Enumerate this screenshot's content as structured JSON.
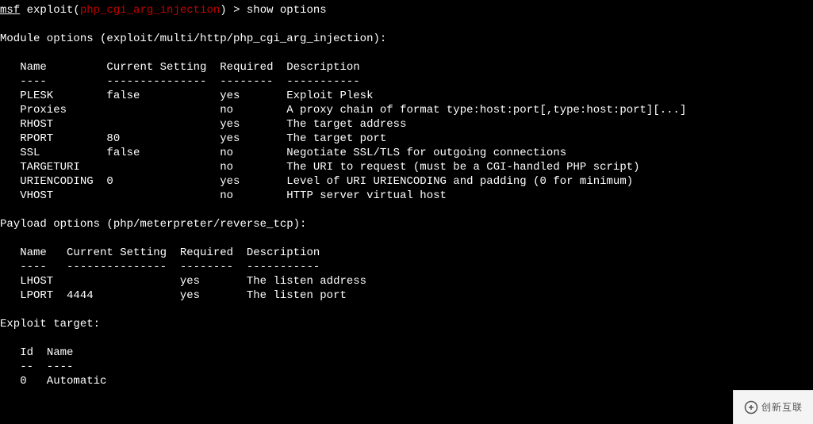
{
  "prompt": {
    "msf": "msf",
    "pre": " exploit(",
    "name": "php_cgi_arg_injection",
    "post": ") > ",
    "cmd": "show options"
  },
  "module_header": "Module options (exploit/multi/http/php_cgi_arg_injection):",
  "module_cols": {
    "name": "Name",
    "setting": "Current Setting",
    "required": "Required",
    "desc": "Description"
  },
  "module_divider": {
    "name": "----",
    "setting": "---------------",
    "required": "--------",
    "desc": "-----------"
  },
  "module_rows": [
    {
      "name": "PLESK",
      "setting": "false",
      "required": "yes",
      "desc": "Exploit Plesk"
    },
    {
      "name": "Proxies",
      "setting": "",
      "required": "no",
      "desc": "A proxy chain of format type:host:port[,type:host:port][...]"
    },
    {
      "name": "RHOST",
      "setting": "",
      "required": "yes",
      "desc": "The target address"
    },
    {
      "name": "RPORT",
      "setting": "80",
      "required": "yes",
      "desc": "The target port"
    },
    {
      "name": "SSL",
      "setting": "false",
      "required": "no",
      "desc": "Negotiate SSL/TLS for outgoing connections"
    },
    {
      "name": "TARGETURI",
      "setting": "",
      "required": "no",
      "desc": "The URI to request (must be a CGI-handled PHP script)"
    },
    {
      "name": "URIENCODING",
      "setting": "0",
      "required": "yes",
      "desc": "Level of URI URIENCODING and padding (0 for minimum)"
    },
    {
      "name": "VHOST",
      "setting": "",
      "required": "no",
      "desc": "HTTP server virtual host"
    }
  ],
  "payload_header": "Payload options (php/meterpreter/reverse_tcp):",
  "payload_cols": {
    "name": "Name",
    "setting": "Current Setting",
    "required": "Required",
    "desc": "Description"
  },
  "payload_divider": {
    "name": "----",
    "setting": "---------------",
    "required": "--------",
    "desc": "-----------"
  },
  "payload_rows": [
    {
      "name": "LHOST",
      "setting": "",
      "required": "yes",
      "desc": "The listen address"
    },
    {
      "name": "LPORT",
      "setting": "4444",
      "required": "yes",
      "desc": "The listen port"
    }
  ],
  "target_header": "Exploit target:",
  "target_cols": {
    "id": "Id",
    "name": "Name"
  },
  "target_divider": {
    "id": "--",
    "name": "----"
  },
  "target_rows": [
    {
      "id": "0",
      "name": "Automatic"
    }
  ],
  "watermark": "创新互联"
}
